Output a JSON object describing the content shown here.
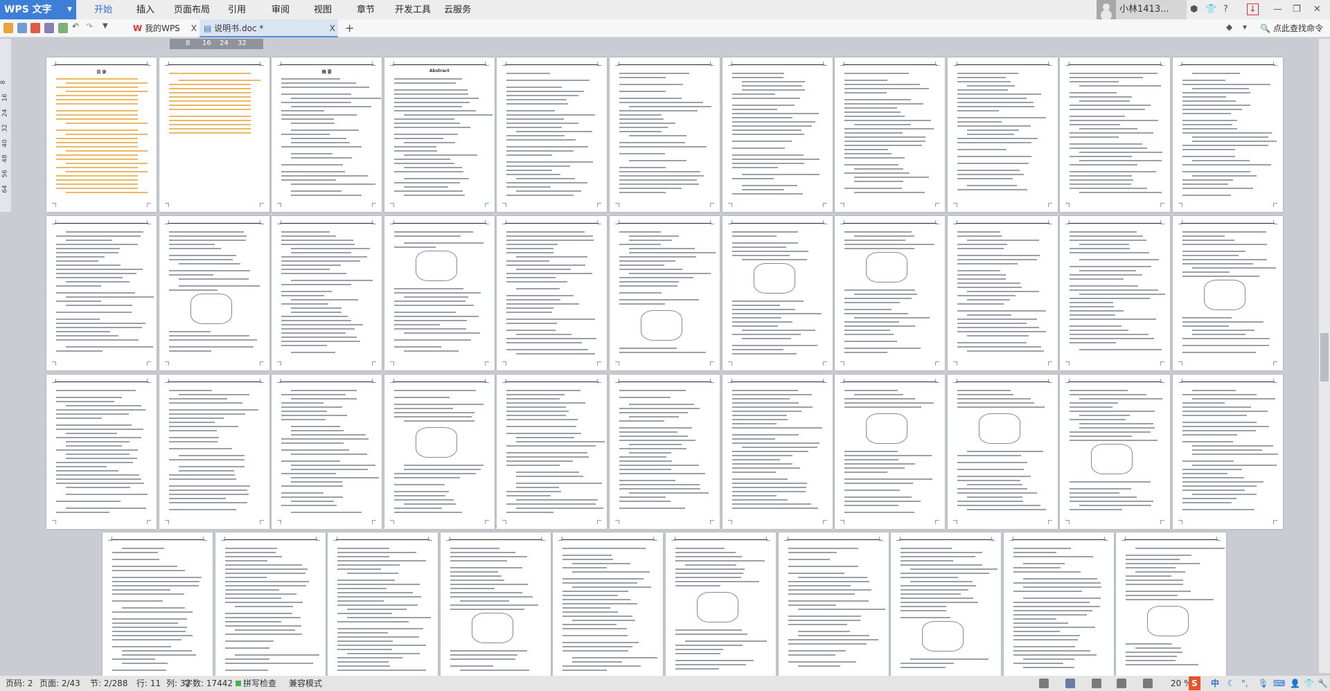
{
  "app": {
    "name": "WPS 文字"
  },
  "menu": [
    "开始",
    "插入",
    "页面布局",
    "引用",
    "审阅",
    "视图",
    "章节",
    "开发工具",
    "云服务"
  ],
  "user": {
    "name": "小林1413..."
  },
  "window": {
    "controls": [
      "minimize-icon",
      "restore-icon",
      "close-icon"
    ]
  },
  "doc_tabs": [
    {
      "label": "我的WPS",
      "close": "X"
    },
    {
      "label": "说明书.doc *",
      "close": "X"
    }
  ],
  "new_tab": "+",
  "search": {
    "label": "点此查找命令"
  },
  "ruler": {
    "h": [
      "8",
      "16",
      "24",
      "32"
    ],
    "v": [
      "8",
      "16",
      "24",
      "32",
      "40",
      "48",
      "56",
      "64"
    ]
  },
  "pages": {
    "total": 43,
    "per_row": [
      11,
      11,
      11,
      10
    ],
    "page1_title": "目 录",
    "abstract_title": "摘 要",
    "en_abstract_title": "Abstract"
  },
  "status": {
    "page_code": "页码: 2",
    "page": "页面: 2/43",
    "section": "节: 2/288",
    "line": "行: 11",
    "col": "列: 32",
    "words": "字数: 17442",
    "spell": "拼写检查",
    "compat": "兼容模式",
    "zoom": "20 %"
  },
  "ime": {
    "lang": "中",
    "punct": "°,"
  }
}
